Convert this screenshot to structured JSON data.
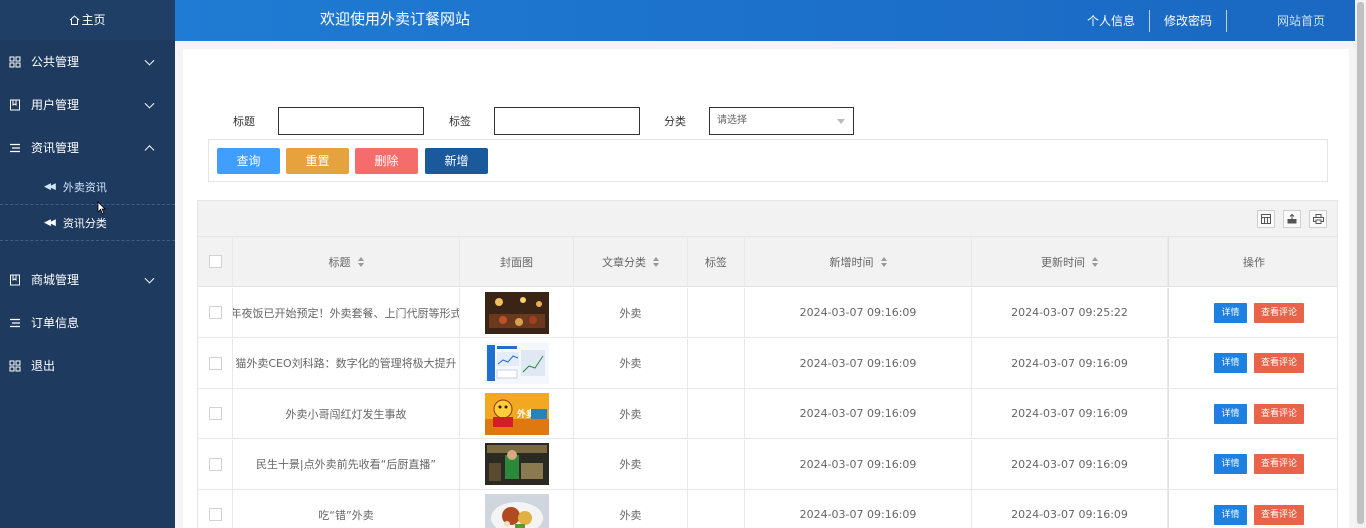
{
  "sidebar": {
    "home": "主页",
    "items": [
      {
        "label": "公共管理"
      },
      {
        "label": "用户管理"
      },
      {
        "label": "资讯管理"
      },
      {
        "label": "商城管理"
      },
      {
        "label": "订单信息"
      },
      {
        "label": "退出"
      }
    ],
    "sub_items": [
      {
        "label": "外卖资讯"
      },
      {
        "label": "资讯分类"
      }
    ]
  },
  "topbar": {
    "title": "欢迎使用外卖订餐网站",
    "profile": "个人信息",
    "password": "修改密码",
    "site_home": "网站首页"
  },
  "search": {
    "title_label": "标题",
    "tag_label": "标签",
    "category_label": "分类",
    "category_placeholder": "请选择"
  },
  "buttons": {
    "query": "查询",
    "reset": "重置",
    "delete": "删除",
    "add": "新增"
  },
  "table": {
    "headers": {
      "title": "标题",
      "cover": "封面图",
      "category": "文章分类",
      "tag": "标签",
      "created": "新增时间",
      "updated": "更新时间",
      "ops": "操作"
    },
    "detail_label": "详情",
    "comment_label": "查看评论",
    "rows": [
      {
        "title": "年夜饭已开始预定！外卖套餐、上门代厨等形式",
        "category": "外卖",
        "tag": "",
        "created": "2024-03-07 09:16:09",
        "updated": "2024-03-07 09:25:22"
      },
      {
        "title": "猫外卖CEO刘科路：数字化的管理将极大提升",
        "category": "外卖",
        "tag": "",
        "created": "2024-03-07 09:16:09",
        "updated": "2024-03-07 09:16:09"
      },
      {
        "title": "外卖小哥闯红灯发生事故",
        "category": "外卖",
        "tag": "",
        "created": "2024-03-07 09:16:09",
        "updated": "2024-03-07 09:16:09"
      },
      {
        "title": "民生十景|点外卖前先收看“后厨直播”",
        "category": "外卖",
        "tag": "",
        "created": "2024-03-07 09:16:09",
        "updated": "2024-03-07 09:16:09"
      },
      {
        "title": "吃“错”外卖",
        "category": "外卖",
        "tag": "",
        "created": "2024-03-07 09:16:09",
        "updated": "2024-03-07 09:16:09"
      }
    ]
  },
  "colors": {
    "sidebar": "#1e3a5f",
    "topbar": "#1f7bd3",
    "query": "#409eff",
    "reset": "#e6a23c",
    "delete": "#f56c6c",
    "add": "#1a5a9c",
    "detail": "#1e80e0",
    "comment": "#e8634a"
  }
}
